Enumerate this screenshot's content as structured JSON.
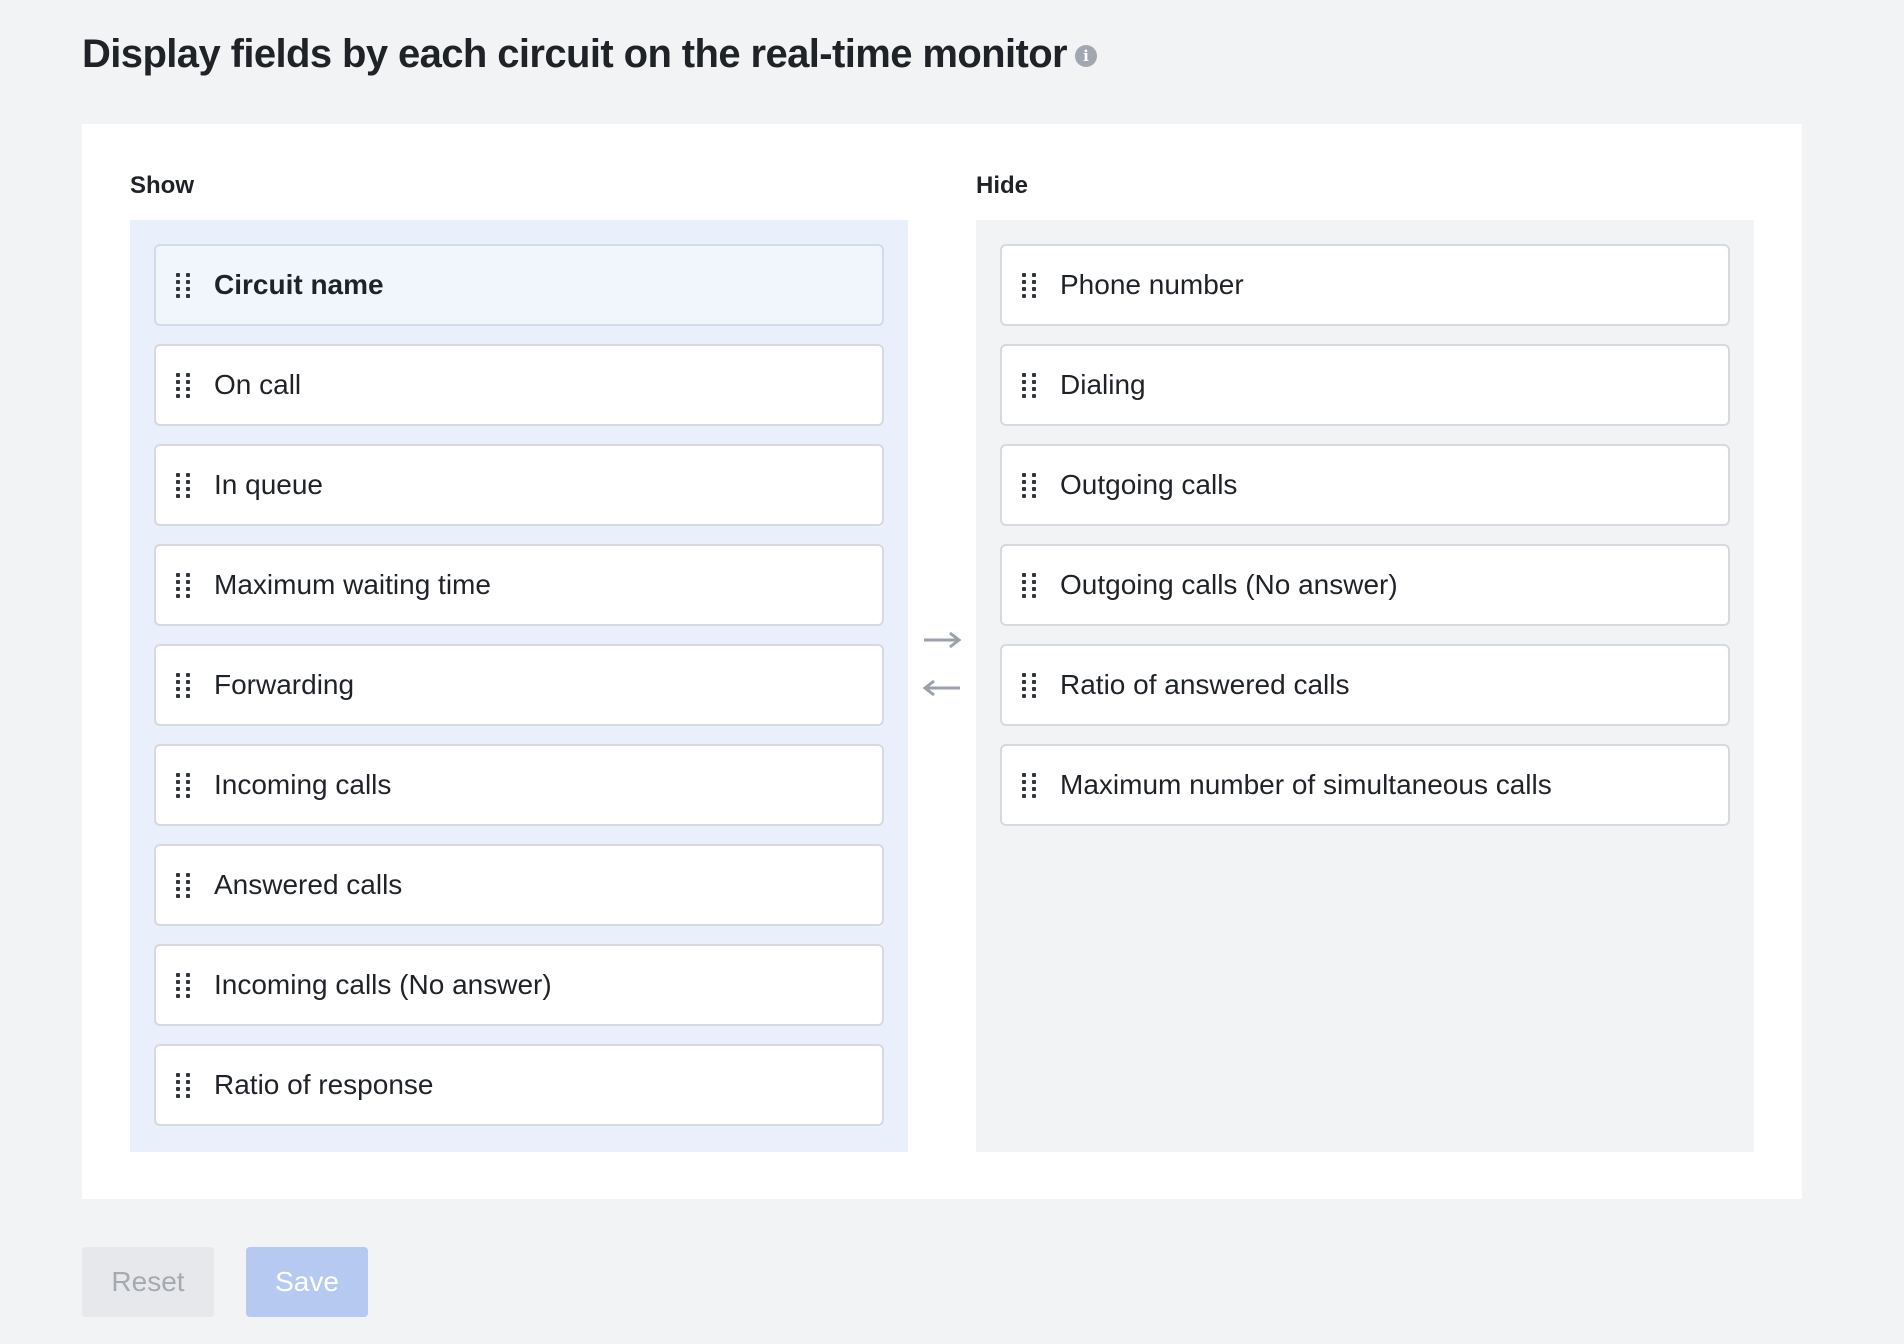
{
  "header": {
    "title": "Display fields by each circuit on the real-time monitor",
    "info_icon": "info-icon",
    "info_glyph": "i"
  },
  "show": {
    "label": "Show",
    "items": [
      {
        "label": "Circuit name"
      },
      {
        "label": "On call"
      },
      {
        "label": "In queue"
      },
      {
        "label": "Maximum waiting time"
      },
      {
        "label": "Forwarding"
      },
      {
        "label": "Incoming calls"
      },
      {
        "label": "Answered calls"
      },
      {
        "label": "Incoming calls (No answer)"
      },
      {
        "label": "Ratio of response"
      }
    ]
  },
  "hide": {
    "label": "Hide",
    "items": [
      {
        "label": "Phone number"
      },
      {
        "label": "Dialing"
      },
      {
        "label": "Outgoing calls"
      },
      {
        "label": "Outgoing calls (No answer)"
      },
      {
        "label": "Ratio of answered calls"
      },
      {
        "label": "Maximum number of simultaneous calls"
      }
    ]
  },
  "transfer": {
    "to_hide_icon": "arrow-right-icon",
    "to_show_icon": "arrow-left-icon"
  },
  "actions": {
    "reset_label": "Reset",
    "save_label": "Save"
  },
  "colors": {
    "show_panel_bg": "#e9f0fb",
    "hide_panel_bg": "#f2f3f5",
    "save_button_bg": "#b5c9f1",
    "reset_button_bg": "#e6e8eb"
  }
}
